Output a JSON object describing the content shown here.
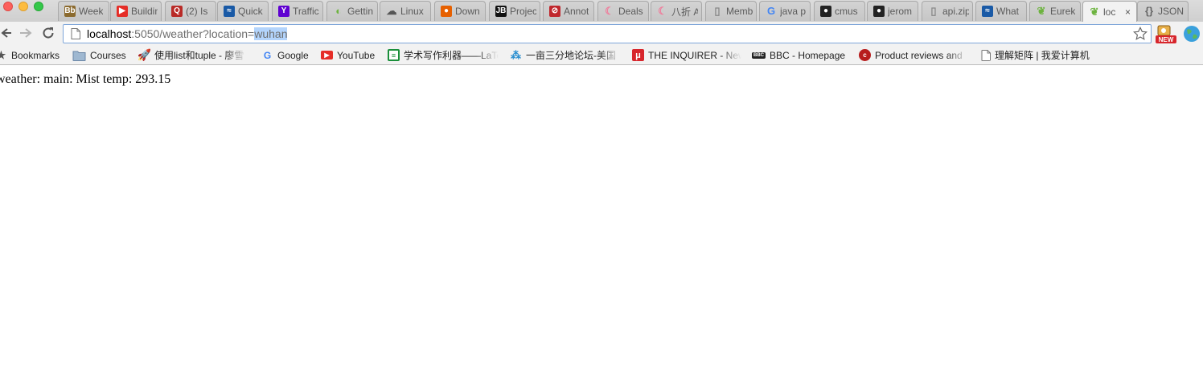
{
  "tabs": [
    {
      "title": "Week",
      "icon": "blackboard-icon",
      "color": "#8b6a2e",
      "glyph": "Bb"
    },
    {
      "title": "Buildin",
      "icon": "youtube-icon",
      "color": "#e52d27",
      "glyph": "▶"
    },
    {
      "title": "(2) Is",
      "icon": "quora-icon",
      "color": "#b92b27",
      "glyph": "Q"
    },
    {
      "title": "Quick",
      "icon": "site-icon",
      "color": "#1a5aa6",
      "glyph": "≈"
    },
    {
      "title": "Traffic",
      "icon": "yahoo-icon",
      "color": "#5f01d1",
      "glyph": "Y"
    },
    {
      "title": "Gettin",
      "icon": "spring-icon",
      "color": "#6db33f",
      "glyph": "◐"
    },
    {
      "title": "Linux",
      "icon": "cloud-icon",
      "color": "#555555",
      "glyph": "☁"
    },
    {
      "title": "Down",
      "icon": "firefox-icon",
      "color": "#e66000",
      "glyph": "●"
    },
    {
      "title": "Projec",
      "icon": "jetbrains-icon",
      "color": "#111111",
      "glyph": "JB"
    },
    {
      "title": "Annot",
      "icon": "blocked-icon",
      "color": "#c0272d",
      "glyph": "⊘"
    },
    {
      "title": "Deals",
      "icon": "moon-icon",
      "color": "#f07c9b",
      "glyph": "☾"
    },
    {
      "title": "八折 A",
      "icon": "moon-icon",
      "color": "#f07c9b",
      "glyph": "☾"
    },
    {
      "title": "Memb",
      "icon": "document-icon",
      "color": "#888888",
      "glyph": "▯"
    },
    {
      "title": "java p",
      "icon": "google-icon",
      "color": "#4285f4",
      "glyph": "G"
    },
    {
      "title": "cmus",
      "icon": "github-icon",
      "color": "#222222",
      "glyph": "●"
    },
    {
      "title": "jerom",
      "icon": "github-icon",
      "color": "#222222",
      "glyph": "●"
    },
    {
      "title": "api.zip",
      "icon": "document-icon",
      "color": "#888888",
      "glyph": "▯"
    },
    {
      "title": "What",
      "icon": "site-icon",
      "color": "#1a5aa6",
      "glyph": "≈"
    },
    {
      "title": "Eurek",
      "icon": "spring-leaf-icon",
      "color": "#6db33f",
      "glyph": "❦"
    },
    {
      "title": "loc",
      "icon": "spring-leaf-icon",
      "color": "#6db33f",
      "glyph": "❦",
      "active": true
    },
    {
      "title": "JSON",
      "icon": "json-icon",
      "color": "#666666",
      "glyph": "{}"
    }
  ],
  "active_tab_close": "×",
  "address_bar": {
    "host": "localhost",
    "path": ":5050/weather?location=",
    "selected": "wuhan"
  },
  "bookmarks": [
    {
      "label": "Bookmarks",
      "icon": "star-icon"
    },
    {
      "label": "Courses",
      "icon": "folder-icon"
    },
    {
      "label": "使用list和tuple - 廖雪",
      "icon": "rocket-icon"
    },
    {
      "label": "Google",
      "icon": "google-icon"
    },
    {
      "label": "YouTube",
      "icon": "youtube-icon"
    },
    {
      "label": "学术写作利器——LaTe",
      "icon": "latex-icon"
    },
    {
      "label": "一亩三分地论坛-美国",
      "icon": "forum-icon"
    },
    {
      "label": "THE INQUIRER - New",
      "icon": "inquirer-icon"
    },
    {
      "label": "BBC - Homepage",
      "icon": "bbc-icon"
    },
    {
      "label": "Product reviews and",
      "icon": "cnet-icon"
    },
    {
      "label": "理解矩阵 | 我爱计算机",
      "icon": "document-icon"
    }
  ],
  "content": {
    "text": "weather: main: Mist temp: 293.15"
  }
}
